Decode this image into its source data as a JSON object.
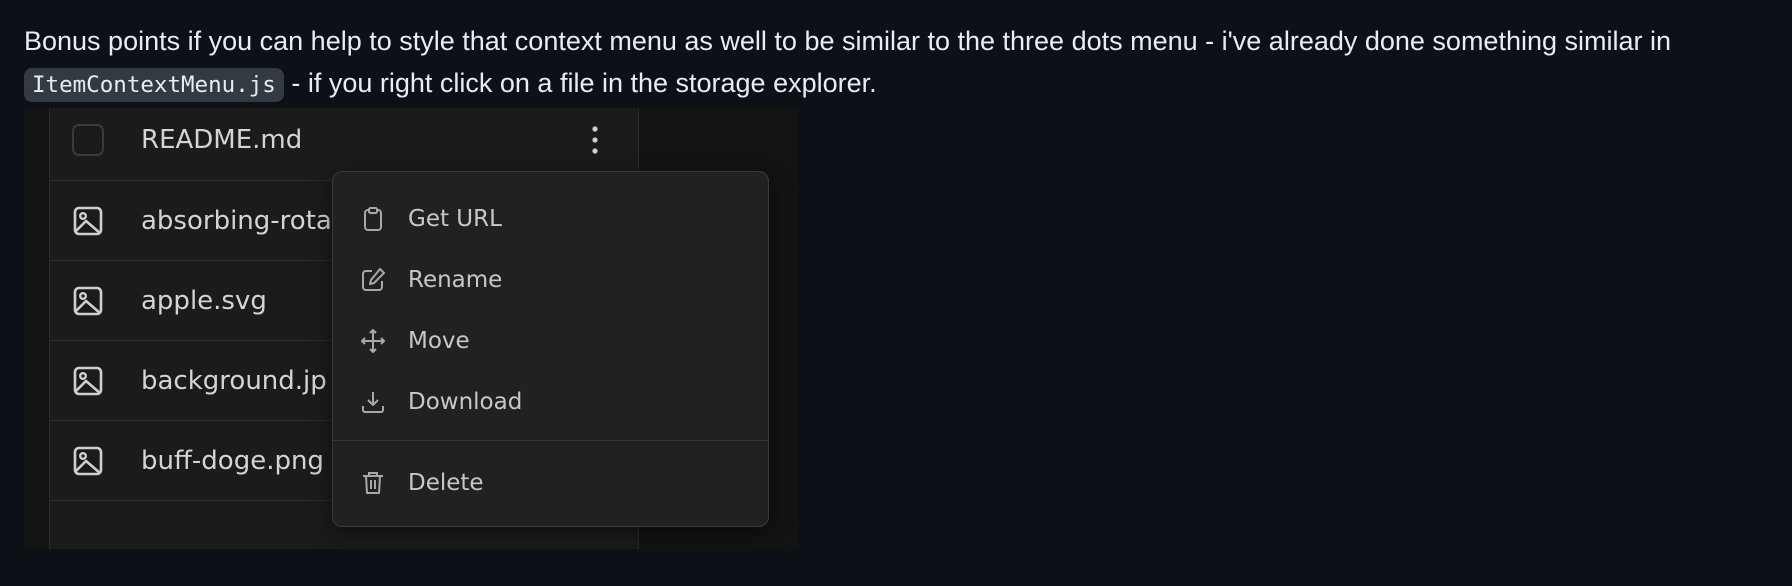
{
  "comment": {
    "text_before_code": "Bonus points if you can help to style that context menu as well to be similar to the three dots menu - i've already done something similar in ",
    "code": "ItemContextMenu.js",
    "text_after_code": " - if you right click on a file in the storage explorer."
  },
  "file_list": {
    "files": [
      {
        "name": "README.md",
        "icon": "checkbox-icon"
      },
      {
        "name": "absorbing-rota",
        "icon": "image-file-icon"
      },
      {
        "name": "apple.svg",
        "icon": "image-file-icon"
      },
      {
        "name": "background.jp",
        "icon": "image-file-icon"
      },
      {
        "name": "buff-doge.png",
        "icon": "image-file-icon"
      }
    ],
    "more_actions_icon": "vertical-ellipsis-icon"
  },
  "context_menu": {
    "items": [
      {
        "label": "Get URL",
        "icon": "clipboard-icon"
      },
      {
        "label": "Rename",
        "icon": "edit-icon"
      },
      {
        "label": "Move",
        "icon": "move-arrows-icon"
      },
      {
        "label": "Download",
        "icon": "download-icon"
      },
      {
        "label": "Delete",
        "icon": "trash-icon"
      }
    ]
  },
  "colors": {
    "page_background": "#0d1117",
    "comment_text": "#e6edf3",
    "code_background": "#343a42",
    "panel_background": "#1b1b1b",
    "menu_background": "#212121",
    "menu_text": "#c8c8c8",
    "file_text": "#d4d4d4"
  }
}
